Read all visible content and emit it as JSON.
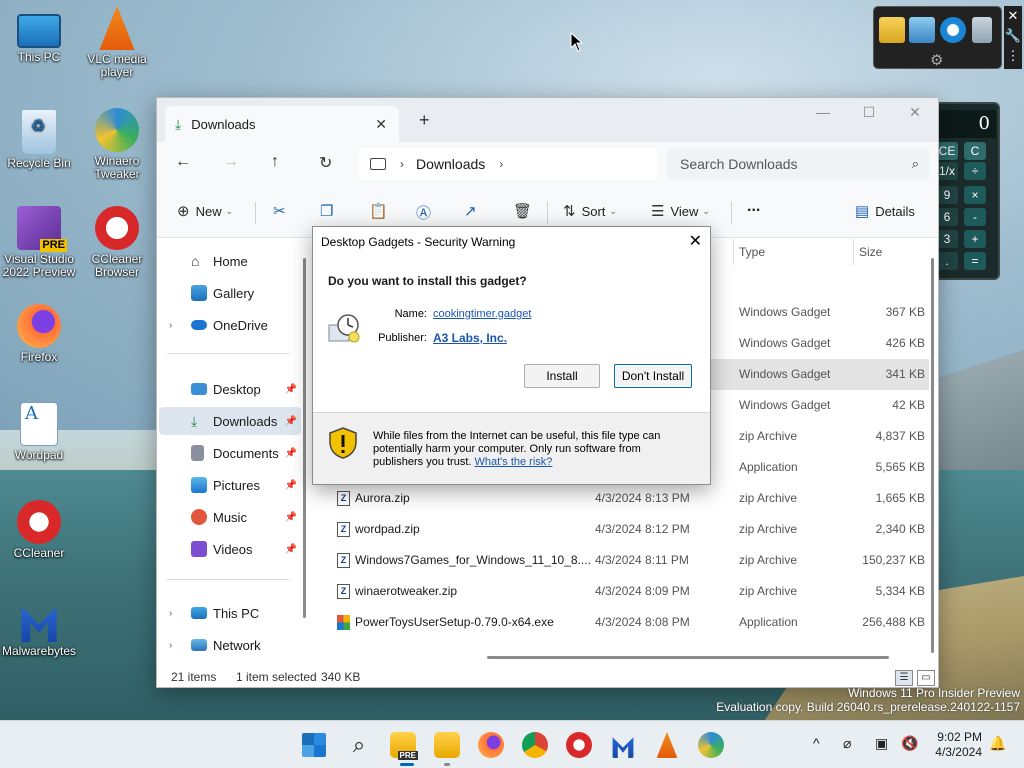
{
  "desktop": {
    "icons": [
      {
        "label": "This PC"
      },
      {
        "label": "VLC media player"
      },
      {
        "label": "Recycle Bin"
      },
      {
        "label": "Winaero Tweaker"
      },
      {
        "label": "Visual Studio 2022 Preview"
      },
      {
        "label": "CCleaner Browser"
      },
      {
        "label": "Firefox"
      },
      {
        "label": "Wordpad"
      },
      {
        "label": "CCleaner"
      },
      {
        "label": "Malwarebytes"
      }
    ],
    "pre_badge": "PRE"
  },
  "calculator": {
    "display": "0",
    "keys": [
      "CE",
      "C",
      "1/x",
      "÷",
      "9",
      "×",
      "6",
      "-",
      "3",
      "+",
      ".",
      "="
    ]
  },
  "explorer": {
    "tab_title": "Downloads",
    "address": {
      "crumb": "Downloads"
    },
    "search_placeholder": "Search Downloads",
    "toolbar": {
      "new_label": "New",
      "sort_label": "Sort",
      "view_label": "View",
      "more_label": "...",
      "details_label": "Details"
    },
    "sidebar": {
      "home": "Home",
      "gallery": "Gallery",
      "onedrive": "OneDrive",
      "desktop": "Desktop",
      "downloads": "Downloads",
      "documents": "Documents",
      "pictures": "Pictures",
      "music": "Music",
      "videos": "Videos",
      "thispc": "This PC",
      "network": "Network"
    },
    "columns": {
      "type": "Type",
      "size": "Size"
    },
    "rows": [
      {
        "name": "",
        "date": "",
        "type": "Windows Gadget",
        "size": "367 KB"
      },
      {
        "name": "",
        "date": "",
        "type": "Windows Gadget",
        "size": "426 KB"
      },
      {
        "name": "",
        "date": "",
        "type": "Windows Gadget",
        "size": "341 KB"
      },
      {
        "name": "",
        "date": "",
        "type": "Windows Gadget",
        "size": "42 KB"
      },
      {
        "name": "",
        "date": "",
        "type": "zip Archive",
        "size": "4,837 KB"
      },
      {
        "name": "",
        "date": "",
        "type": "Application",
        "size": "5,565 KB"
      },
      {
        "name": "Aurora.zip",
        "date": "4/3/2024 8:13 PM",
        "type": "zip Archive",
        "size": "1,665 KB"
      },
      {
        "name": "wordpad.zip",
        "date": "4/3/2024 8:12 PM",
        "type": "zip Archive",
        "size": "2,340 KB"
      },
      {
        "name": "Windows7Games_for_Windows_11_10_8....",
        "date": "4/3/2024 8:11 PM",
        "type": "zip Archive",
        "size": "150,237 KB"
      },
      {
        "name": "winaerotweaker.zip",
        "date": "4/3/2024 8:09 PM",
        "type": "zip Archive",
        "size": "5,334 KB"
      },
      {
        "name": "PowerToysUserSetup-0.79.0-x64.exe",
        "date": "4/3/2024 8:08 PM",
        "type": "Application",
        "size": "256,488 KB"
      }
    ],
    "status": {
      "count": "21 items",
      "selected": "1 item selected",
      "size": "340 KB"
    }
  },
  "dialog": {
    "title": "Desktop Gadgets - Security Warning",
    "question": "Do you want to install this gadget?",
    "name_label": "Name:",
    "name_value": "cookingtimer.gadget",
    "publisher_label": "Publisher:",
    "publisher_value": "A3 Labs, Inc.",
    "install_label": "Install",
    "dont_install_label": "Don't Install",
    "warning_text": "While files from the Internet can be useful, this file type can potentially harm your computer. Only run software from publishers you trust.",
    "risk_link": "What's the risk?"
  },
  "watermark": {
    "line1": "Windows 11 Pro Insider Preview",
    "line2": "Evaluation copy. Build 26040.rs_prerelease.240122-1157"
  },
  "taskbar": {
    "pre_badge": "PRE",
    "time": "9:02 PM",
    "date": "4/3/2024"
  },
  "colors": {
    "accent": "#0067c0",
    "link": "#1a56b0",
    "selection": "#e3e3e3"
  }
}
